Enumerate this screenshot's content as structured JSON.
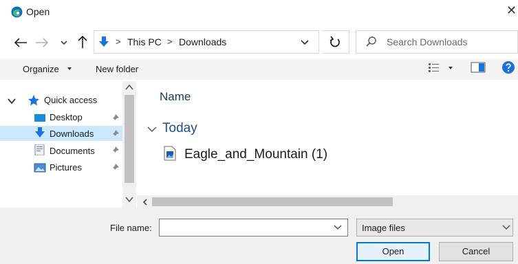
{
  "window": {
    "title": "Open",
    "close_glyph": "✕"
  },
  "navigation": {
    "path": [
      {
        "label": "This PC"
      },
      {
        "label": "Downloads"
      }
    ],
    "separator": ">",
    "search_placeholder": "Search Downloads"
  },
  "toolbar": {
    "organize_label": "Organize",
    "new_folder_label": "New folder"
  },
  "sidebar": {
    "items": [
      {
        "label": "Quick access",
        "icon": "star-icon",
        "pinned": false
      },
      {
        "label": "Desktop",
        "icon": "desktop-icon",
        "pinned": true
      },
      {
        "label": "Downloads",
        "icon": "download-icon",
        "pinned": true,
        "selected": true
      },
      {
        "label": "Documents",
        "icon": "documents-icon",
        "pinned": true
      },
      {
        "label": "Pictures",
        "icon": "pictures-icon",
        "pinned": true
      }
    ]
  },
  "content": {
    "column_header": "Name",
    "groups": [
      {
        "label": "Today",
        "files": [
          {
            "name": "Eagle_and_Mountain (1)",
            "icon": "image-file-icon"
          }
        ]
      }
    ]
  },
  "footer": {
    "file_name_label": "File name:",
    "file_name_value": "",
    "file_type_value": "Image files",
    "open_label": "Open",
    "cancel_label": "Cancel"
  },
  "colors": {
    "accent": "#0078d7",
    "selection": "#cce8ff",
    "toolbar_bg": "#f3f3f3",
    "footer_bg": "#f0f0f0",
    "group_text": "#1e4e8c"
  }
}
